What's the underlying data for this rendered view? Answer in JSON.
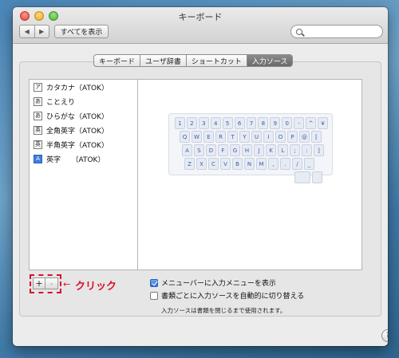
{
  "window": {
    "title": "キーボード"
  },
  "toolbar": {
    "back_icon": "◀",
    "forward_icon": "▶",
    "show_all_label": "すべてを表示",
    "search_value": ""
  },
  "tabs": [
    {
      "label": "キーボード",
      "active": false
    },
    {
      "label": "ユーザ辞書",
      "active": false
    },
    {
      "label": "ショートカット",
      "active": false
    },
    {
      "label": "入力ソース",
      "active": true
    }
  ],
  "input_sources": [
    {
      "icon": "ア",
      "label": "カタカナ（ATOK）"
    },
    {
      "icon": "あ",
      "label": "ことえり"
    },
    {
      "icon": "あ",
      "label": "ひらがな（ATOK）"
    },
    {
      "icon": "英",
      "label": "全角英字（ATOK）"
    },
    {
      "icon": "英",
      "label": "半角英字（ATOK）"
    },
    {
      "icon": "A",
      "label": "英字　　（ATOK）"
    }
  ],
  "keyboard_rows": [
    [
      "1",
      "2",
      "3",
      "4",
      "5",
      "6",
      "7",
      "8",
      "9",
      "0",
      "-",
      "^",
      "¥"
    ],
    [
      "Q",
      "W",
      "E",
      "R",
      "T",
      "Y",
      "U",
      "I",
      "O",
      "P",
      "@",
      "["
    ],
    [
      "A",
      "S",
      "D",
      "F",
      "G",
      "H",
      "J",
      "K",
      "L",
      ";",
      ":",
      "]"
    ],
    [
      "Z",
      "X",
      "C",
      "V",
      "B",
      "N",
      "M",
      ",",
      ".",
      "/",
      "_"
    ]
  ],
  "list_buttons": {
    "add": "+",
    "remove": "-"
  },
  "annotation": {
    "arrow": "←",
    "label": "クリック",
    "color": "#d8102f"
  },
  "options": {
    "show_menu_label": "メニューバーに入力メニューを表示",
    "show_menu_checked": true,
    "auto_switch_label": "書類ごとに入力ソースを自動的に切り替える",
    "auto_switch_checked": false,
    "note": "入力ソースは書類を閉じるまで使用されます。"
  },
  "help": {
    "label": "?"
  }
}
